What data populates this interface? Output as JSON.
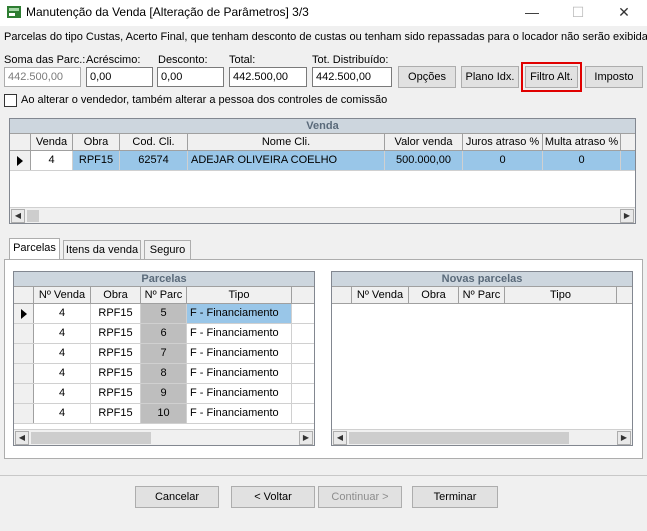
{
  "window": {
    "title": "Manutenção da Venda [Alteração de Parâmetros] 3/3",
    "minimize_glyph": "—",
    "maximize_glyph": "☐",
    "close_glyph": "✕"
  },
  "info_text": "Parcelas do tipo Custas, Acerto Final, que tenham desconto de custas ou tenham sido repassadas para o locador não serão exibidas",
  "fields": {
    "soma_label": "Soma das Parc.:",
    "soma_value": "442.500,00",
    "acrescimo_label": "Acréscimo:",
    "acrescimo_value": "0,00",
    "desconto_label": "Desconto:",
    "desconto_value": "0,00",
    "total_label": "Total:",
    "total_value": "442.500,00",
    "tot_distribuido_label": "Tot. Distribuído:",
    "tot_distribuido_value": "442.500,00"
  },
  "buttons": {
    "opcoes": "Opções",
    "plano_idx": "Plano Idx.",
    "filtro_alt": "Filtro Alt.",
    "imposto": "Imposto"
  },
  "checkbox_label": "Ao alterar o vendedor, também alterar a pessoa dos controles de comissão",
  "venda_grid": {
    "title": "Venda",
    "columns": [
      "Venda",
      "Obra",
      "Cod. Cli.",
      "Nome Cli.",
      "Valor venda",
      "Juros atraso %",
      "Multa atraso %"
    ],
    "rows": [
      [
        "4",
        "RPF15",
        "62574",
        "ADEJAR OLIVEIRA COELHO",
        "500.000,00",
        "0",
        "0"
      ]
    ]
  },
  "tabs": [
    {
      "label": "Parcelas"
    },
    {
      "label": "Itens da venda"
    },
    {
      "label": "Seguro"
    }
  ],
  "parcelas_grid": {
    "title": "Parcelas",
    "columns": [
      "Nº Venda",
      "Obra",
      "Nº Parc",
      "Tipo"
    ],
    "rows": [
      [
        "4",
        "RPF15",
        "5",
        "F - Financiamento"
      ],
      [
        "4",
        "RPF15",
        "6",
        "F - Financiamento"
      ],
      [
        "4",
        "RPF15",
        "7",
        "F - Financiamento"
      ],
      [
        "4",
        "RPF15",
        "8",
        "F - Financiamento"
      ],
      [
        "4",
        "RPF15",
        "9",
        "F - Financiamento"
      ],
      [
        "4",
        "RPF15",
        "10",
        "F - Financiamento"
      ]
    ]
  },
  "novas_grid": {
    "title": "Novas parcelas",
    "columns": [
      "Nº Venda",
      "Obra",
      "Nº Parc",
      "Tipo"
    ]
  },
  "footer": {
    "cancelar": "Cancelar",
    "voltar": "< Voltar",
    "continuar": "Continuar >",
    "terminar": "Terminar"
  },
  "colors": {
    "selection": "#99c6e8",
    "highlight_outline": "#e00000",
    "grid_title": "#cdd6de"
  }
}
